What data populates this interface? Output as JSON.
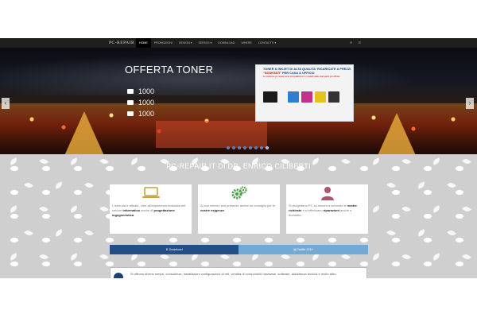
{
  "navbar": {
    "brand": "PC-REPAIR",
    "items": [
      {
        "label": "HOME",
        "active": true
      },
      {
        "label": "PROMOZIONI"
      },
      {
        "label": "DESIGN ▾"
      },
      {
        "label": "SERVIZI ▾"
      },
      {
        "label": "DOWNLOAD"
      },
      {
        "label": "WHERE"
      },
      {
        "label": "CONTACTS ▾"
      }
    ],
    "right_icons": [
      "✉",
      "☰"
    ]
  },
  "slider": {
    "title": "OFFERTA TONER",
    "lines": [
      "1000",
      "1000",
      "1000"
    ],
    "promo_title_part1": "TONER & INKJET DI ALTA QUALITA' RICARICATE A PREZZI ",
    "promo_title_highlight": "\"SCONTATI\"",
    "promo_title_part2": " PER CASA & UFFICIO",
    "promo_sub": "Le cartucce pc-repair sono compatibili con i modelli delle stampanti più diffuse",
    "prev_arrow": "‹",
    "next_arrow": "›",
    "dots_count": 8,
    "active_dot": 7
  },
  "site_title": "PC-REPAIR.IT DI DR. ENRICO CILIBERTI",
  "cards": [
    {
      "icon": "laptop-icon",
      "text_plain": "L'azienda è attuale, oltre all'esperienza maturata nel settore ",
      "text_bold": "informatico",
      "text_plain2": " anche di ",
      "text_bold2": "progettazione ingegneristica",
      "text_end": "."
    },
    {
      "icon": "gears-icon",
      "text_plain": "Al suo interno son presente anche un consiglio per le ",
      "text_bold": "vostre esigenze",
      "text_plain2": ".",
      "text_bold2": "",
      "text_end": ""
    },
    {
      "icon": "user-icon",
      "text_plain": "Si progettano PC su misura a secondo le ",
      "text_bold": "vostre richieste",
      "text_plain2": " e si effettuano ",
      "text_bold2": "riparazioni",
      "text_end": " anche a domicilio."
    }
  ],
  "buttons": {
    "download": "Download",
    "tariffe": "Tariffe 2014"
  },
  "info": {
    "text": "Si offrono diversi servizi, consulenze, installazioni configurazioni di reti, vendita di componenti hardware, software, assistenza tecnica e molto altro."
  },
  "colors": {
    "navbar_bg": "#1e1e1e",
    "download_btn": "#244e86",
    "tariffe_btn": "#74a8d5",
    "content_bg": "#cfcfcf",
    "laptop_icon": "#c2a63a",
    "gears_icon": "#3fa03f",
    "user_icon": "#b0556a"
  }
}
